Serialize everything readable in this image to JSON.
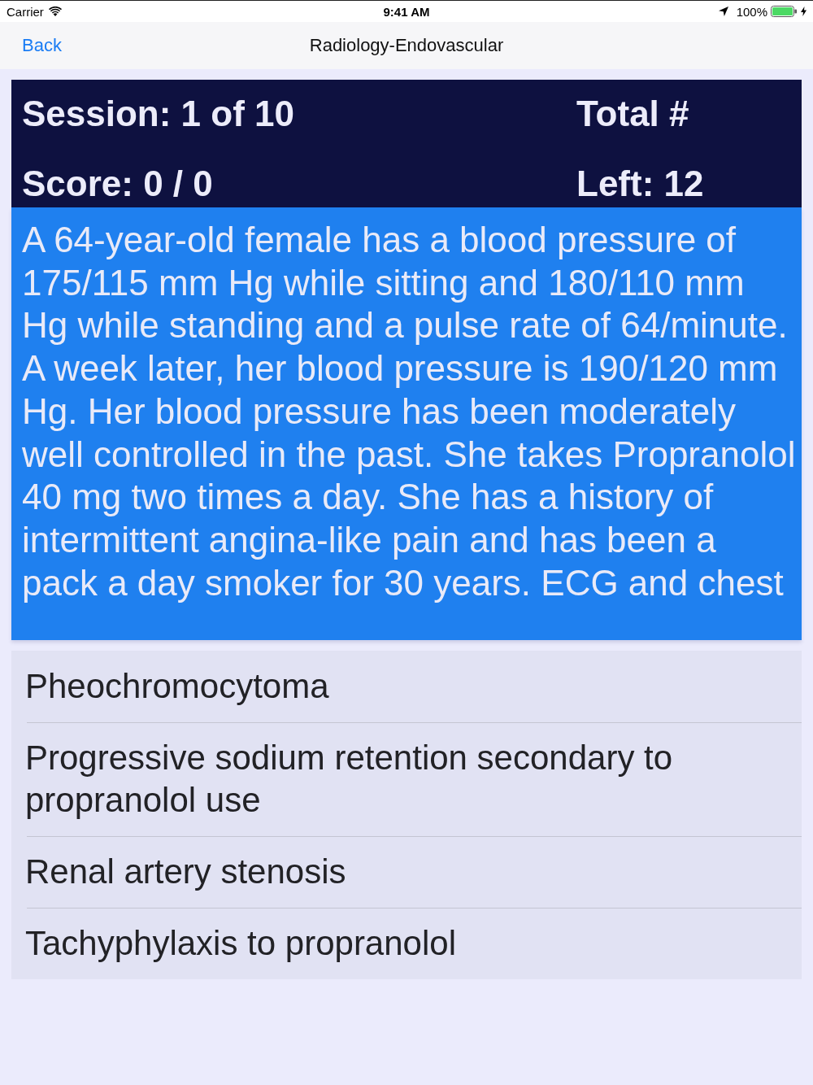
{
  "status_bar": {
    "carrier": "Carrier",
    "time": "9:41 AM",
    "battery": "100%"
  },
  "nav_bar": {
    "back": "Back",
    "title": "Radiology-Endovascular"
  },
  "scoreboard": {
    "session": "Session: 1 of 10",
    "total": "Total #",
    "score": "Score: 0 / 0",
    "left": "Left: 12"
  },
  "question": {
    "text": "A 64-year-old female has a blood pressure of 175/115 mm Hg while sitting and 180/110 mm Hg while standing and a pulse rate of 64/minute. A week later, her blood pressure is 190/120 mm Hg. Her blood pressure has been moderately well controlled in the past. She takes Propranolol 40 mg two times a day. She has a history of intermittent angina-like pain and has been a pack a day smoker for 30 years. ECG and chest"
  },
  "answers": [
    {
      "text": "Pheochromocytoma"
    },
    {
      "text": "Progressive sodium retention secondary to propranolol use"
    },
    {
      "text": "Renal artery stenosis"
    },
    {
      "text": "Tachyphylaxis to propranolol"
    }
  ]
}
